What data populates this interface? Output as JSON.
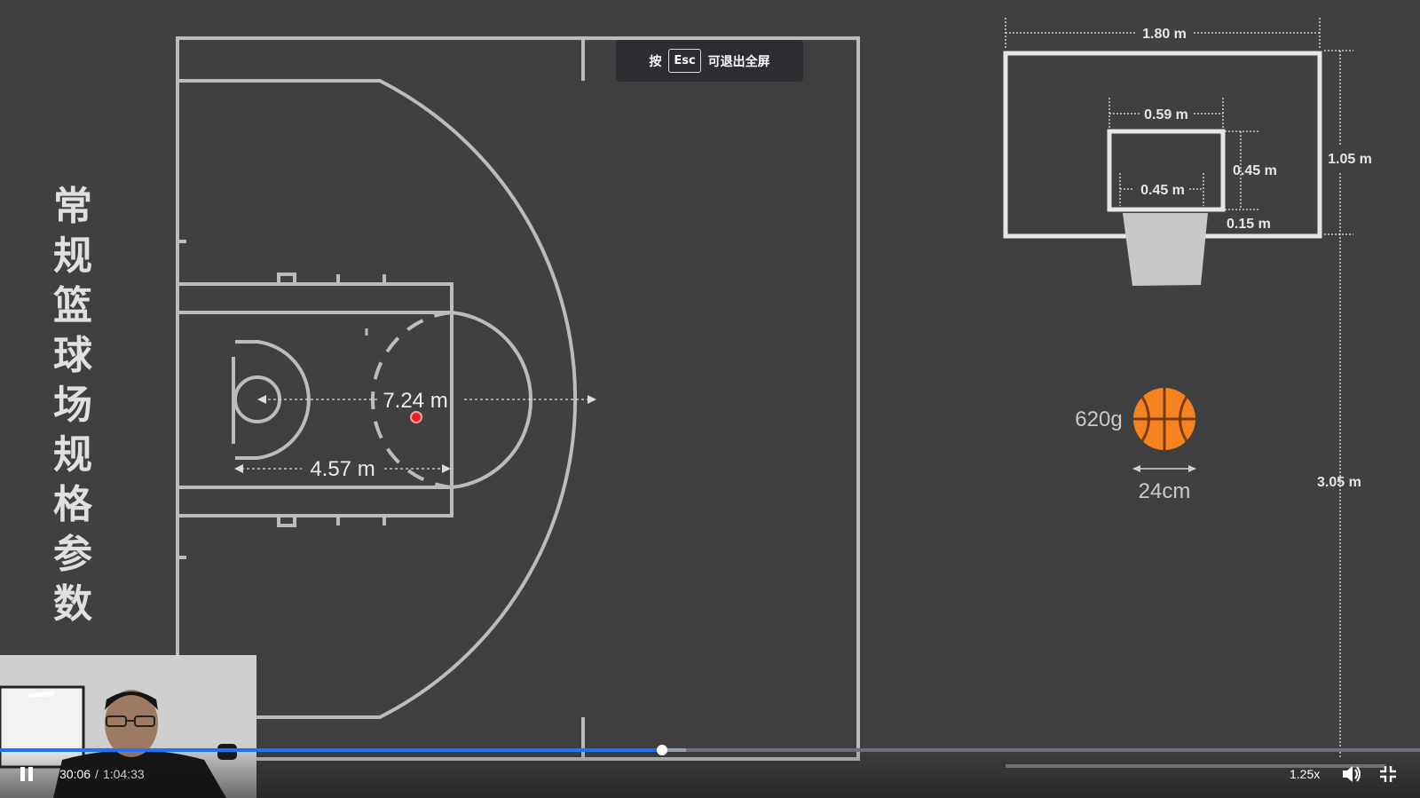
{
  "title": {
    "chars": [
      "常",
      "规",
      "篮",
      "球",
      "场",
      "规",
      "格",
      "参",
      "数"
    ]
  },
  "court": {
    "three_point_label": "7.24 m",
    "free_throw_label": "4.57 m"
  },
  "backboard": {
    "width_label": "1.80 m",
    "height_label": "1.05 m",
    "inner_width_label": "0.59 m",
    "inner_height_label": "0.45 m",
    "rim_label": "0.45 m",
    "offset_label": "0.15 m",
    "hoop_height_label": "3.05 m"
  },
  "ball": {
    "weight_label": "620g",
    "diameter_label": "24cm",
    "color": "#f5831f"
  },
  "esc_hint": {
    "prefix": "按",
    "key": "Esc",
    "suffix": "可退出全屏"
  },
  "player": {
    "current_time": "30:06",
    "separator": "/",
    "duration": "1:04:33",
    "speed": "1.25x",
    "progress_fraction": 0.466,
    "buffered_fraction": 0.483,
    "accent_color": "#1e72ff"
  }
}
